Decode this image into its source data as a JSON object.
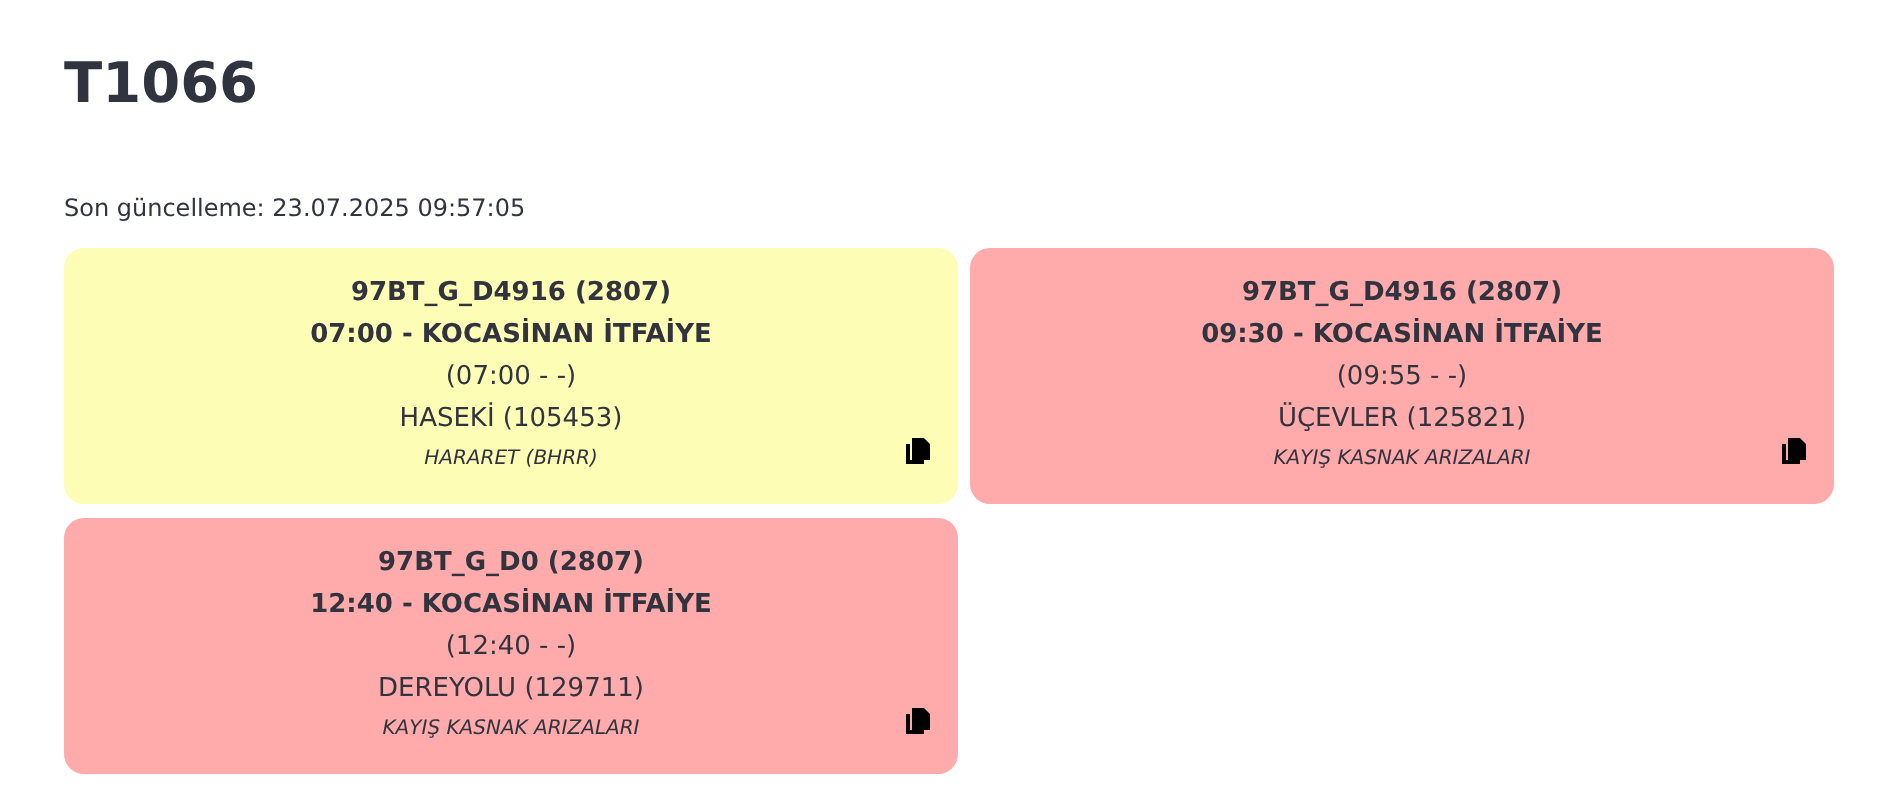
{
  "title": "T1066",
  "last_update": "Son güncelleme: 23.07.2025 09:57:05",
  "cards": [
    {
      "color": "#fdfdb5",
      "code": "97BT_G_D4916 (2807)",
      "route": "07:00 - KOCASİNAN İTFAİYE",
      "times": "(07:00 - -)",
      "stop": "HASEKİ (105453)",
      "reason": "HARARET (BHRR)"
    },
    {
      "color": "#ffabab",
      "code": "97BT_G_D4916 (2807)",
      "route": "09:30 - KOCASİNAN İTFAİYE",
      "times": "(09:55 - -)",
      "stop": "ÜÇEVLER (125821)",
      "reason": "KAYIŞ KASNAK ARIZALARI"
    },
    {
      "color": "#ffabab",
      "code": "97BT_G_D0 (2807)",
      "route": "12:40 - KOCASİNAN İTFAİYE",
      "times": "(12:40 - -)",
      "stop": "DEREYOLU (129711)",
      "reason": "KAYIŞ KASNAK ARIZALARI"
    }
  ]
}
